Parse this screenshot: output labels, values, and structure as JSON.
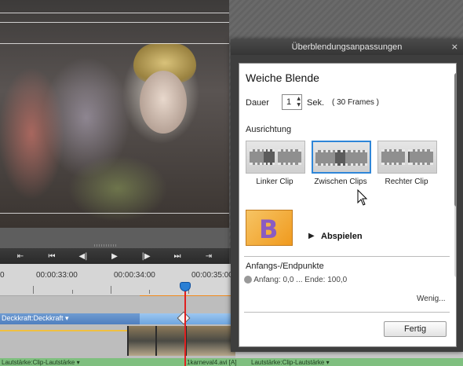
{
  "dialog": {
    "window_title": "Überblendungsanpassungen",
    "close_glyph": "×",
    "heading": "Weiche Blende",
    "duration": {
      "label": "Dauer",
      "value": "1",
      "unit": "Sek.",
      "frames": "( 30 Frames )"
    },
    "alignment": {
      "label": "Ausrichtung",
      "options": [
        {
          "label": "Linker Clip",
          "selected": false
        },
        {
          "label": "Zwischen Clips",
          "selected": true
        },
        {
          "label": "Rechter Clip",
          "selected": false
        }
      ]
    },
    "preview": {
      "thumb_letter": "B",
      "play_label": "Abspielen",
      "play_icon": "play-triangle-icon"
    },
    "points": {
      "label": "Anfangs-/Endpunkte",
      "row_text": "Anfang: 0,0 ... Ende: 100,0"
    },
    "less_link": "Wenig...",
    "done_button": "Fertig"
  },
  "transport": {
    "buttons": [
      "⇤",
      "⏮",
      "◀|",
      "▶",
      "|▶",
      "⏭",
      "⇥"
    ],
    "icons": [
      "go-to-start-icon",
      "previous-edit-icon",
      "step-back-icon",
      "play-icon",
      "step-forward-icon",
      "next-edit-icon",
      "go-to-end-icon"
    ]
  },
  "timeline": {
    "timecodes": [
      "0",
      "00:00:33:00",
      "00:00:34:00",
      "00:00:35:00"
    ],
    "video_track_label": "Deckkraft:Deckkraft ▾",
    "clip_label": "1karneval4.avi [A]",
    "audio_labels": [
      "Lautstärke:Clip-Lautstärke ▾",
      "Lautstärke:Clip-Lautstärke ▾"
    ]
  },
  "colors": {
    "accent_blue": "#2f86d8",
    "playhead_red": "#e02020",
    "work_area_orange": "#f08a1c",
    "audio_green": "#7fbf7f"
  }
}
